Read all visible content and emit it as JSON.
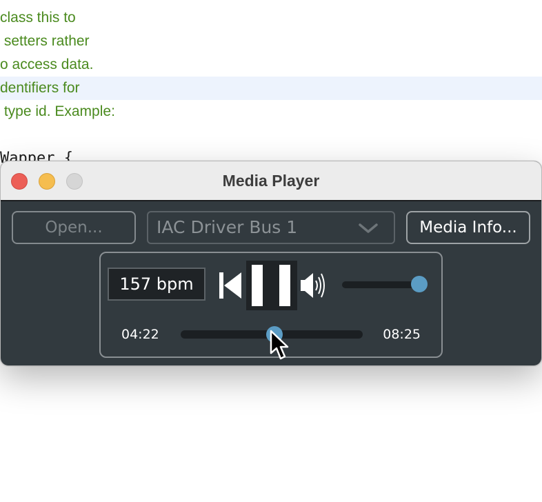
{
  "editor": {
    "lines": [
      "class this to",
      " setters rather",
      "o access data.",
      "dentifiers for",
      " type id. Example:",
      "Wapper {"
    ]
  },
  "window": {
    "title": "Media Player"
  },
  "toolbar": {
    "open_label": "Open...",
    "device_selected": "IAC Driver Bus 1",
    "media_info_label": "Media Info..."
  },
  "transport": {
    "tempo": "157 bpm",
    "volume_level": 1.0,
    "current_time": "04:22",
    "total_time": "08:25",
    "position_fraction": 0.52
  },
  "icons": {
    "skip": "skip-back-icon",
    "pause": "pause-icon",
    "volume": "speaker-icon",
    "chevron": "chevron-down-icon",
    "cursor": "mouse-cursor-icon"
  },
  "colors": {
    "accent": "#5b9cc4",
    "window_bg": "#323a3f",
    "code_comment": "#4a8a1e"
  }
}
